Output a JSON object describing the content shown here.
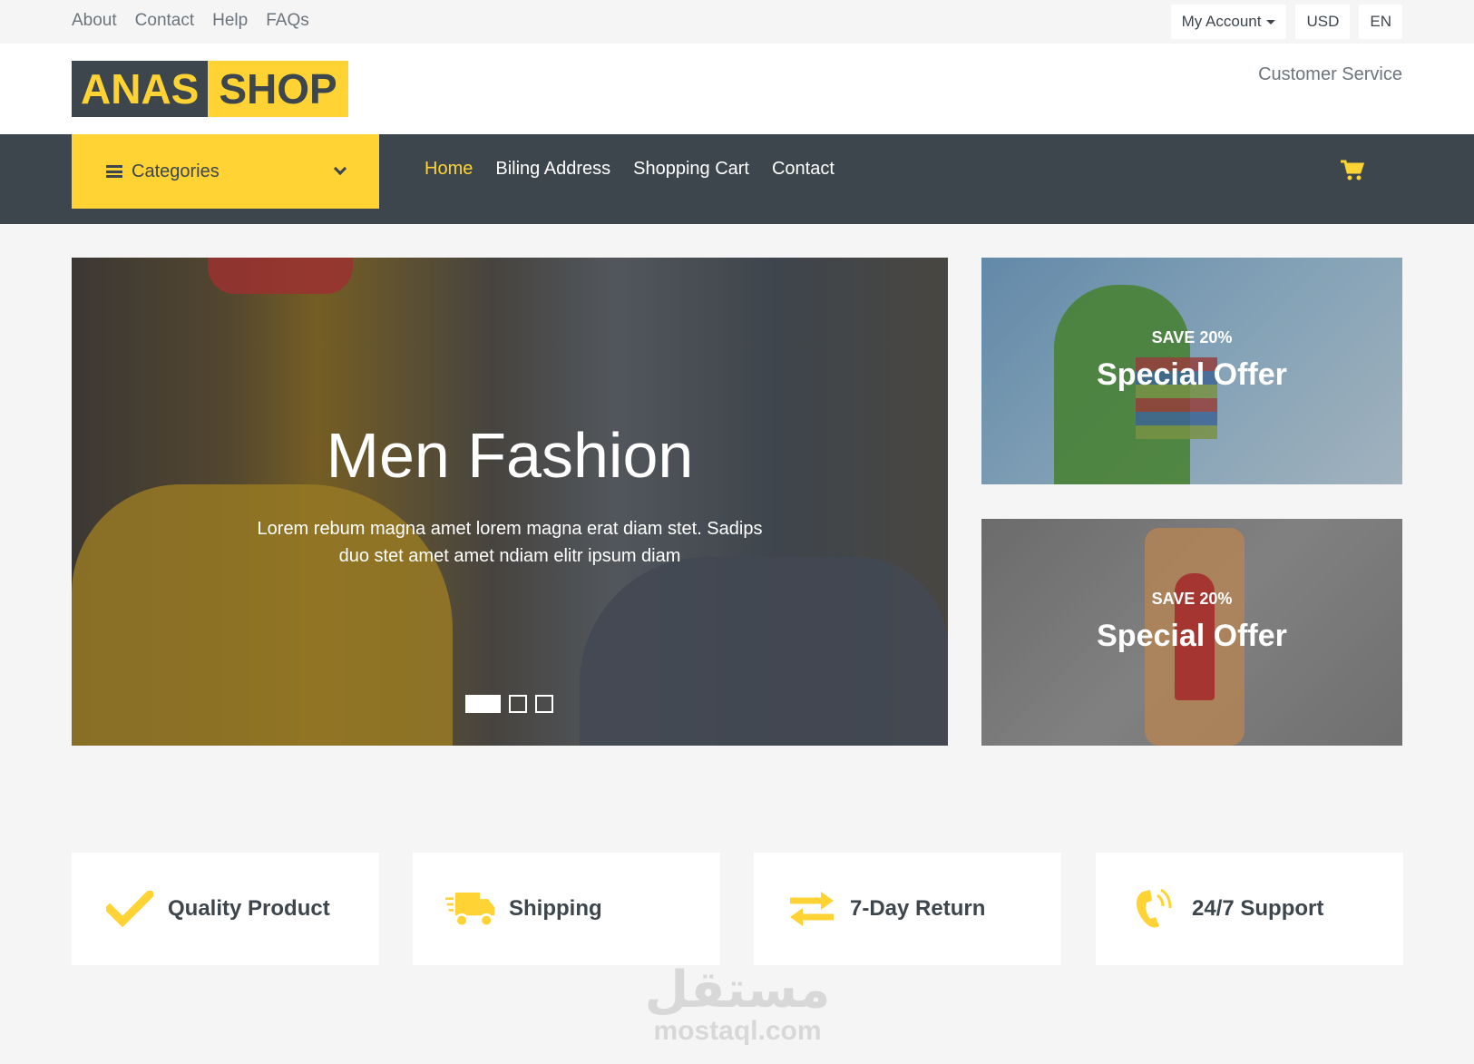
{
  "topbar": {
    "links": [
      "About",
      "Contact",
      "Help",
      "FAQs"
    ],
    "my_account": "My Account",
    "currency": "USD",
    "language": "EN"
  },
  "logo": {
    "part1": "ANAS",
    "part2": "SHOP"
  },
  "customer_service": "Customer Service",
  "nav": {
    "categories_label": "Categories",
    "links": [
      "Home",
      "Biling Address",
      "Shopping Cart",
      "Contact"
    ],
    "active": "Home"
  },
  "hero": {
    "title": "Men Fashion",
    "text": "Lorem rebum magna amet lorem magna erat diam stet. Sadips duo stet amet amet ndiam elitr ipsum diam",
    "slide_count": 3,
    "active_slide": 1
  },
  "offers": [
    {
      "kicker": "SAVE 20%",
      "title": "Special Offer"
    },
    {
      "kicker": "SAVE 20%",
      "title": "Special Offer"
    }
  ],
  "features": [
    {
      "icon": "check-icon",
      "label": "Quality Product"
    },
    {
      "icon": "truck-icon",
      "label": "Shipping"
    },
    {
      "icon": "exchange-icon",
      "label": "7-Day Return"
    },
    {
      "icon": "phone-icon",
      "label": "24/7 Support"
    }
  ],
  "watermark": {
    "arabic": "مستقل",
    "latin": "mostaql.com"
  },
  "colors": {
    "accent": "#ffd333",
    "dark": "#3d464d",
    "muted": "#6c757d",
    "background": "#f5f5f5"
  }
}
